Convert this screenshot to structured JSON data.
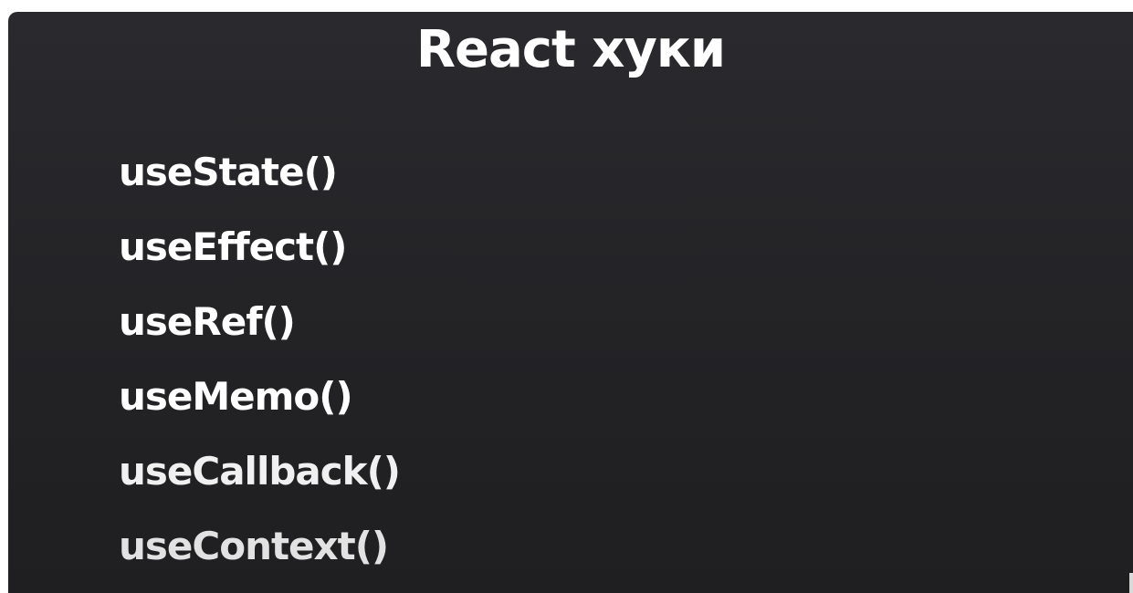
{
  "slide": {
    "title": "React хуки",
    "hooks": [
      {
        "label": "useState()",
        "color": "#ffffff"
      },
      {
        "label": "useEffect()",
        "color": "#ffffff"
      },
      {
        "label": "useRef()",
        "color": "#ffffff"
      },
      {
        "label": "useMemo()",
        "color": "#ffffff"
      },
      {
        "label": "useCallback()",
        "color": "#f0f0f0"
      },
      {
        "label": "useContext()",
        "color": "#e2e2e2"
      }
    ]
  }
}
